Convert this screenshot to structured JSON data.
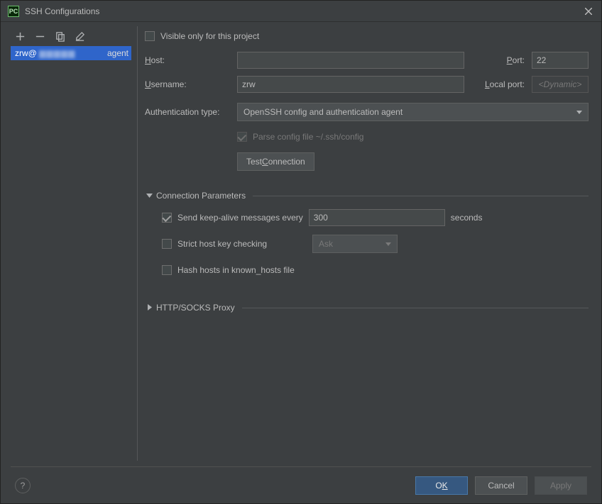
{
  "titlebar": {
    "app_icon_text": "PC",
    "title": "SSH Configurations"
  },
  "sidebar": {
    "selected": {
      "label": "zrw@",
      "method": "agent"
    }
  },
  "form": {
    "visible_only_label": "Visible only for this project",
    "visible_only_checked": false,
    "host_label": "Host:",
    "host_value": "",
    "port_label": "Port:",
    "port_value": "22",
    "username_label": "Username:",
    "username_value": "zrw",
    "local_port_label": "Local port:",
    "local_port_placeholder": "<Dynamic>",
    "auth_type_label": "Authentication type:",
    "auth_type_value": "OpenSSH config and authentication agent",
    "parse_config_label": "Parse config file ~/.ssh/config",
    "parse_config_checked": true,
    "test_connection_label": "Test Connection"
  },
  "conn_params": {
    "title": "Connection Parameters",
    "keepalive_label": "Send keep-alive messages every",
    "keepalive_checked": true,
    "keepalive_value": "300",
    "keepalive_suffix": "seconds",
    "strict_label": "Strict host key checking",
    "strict_checked": false,
    "strict_mode": "Ask",
    "hash_label": "Hash hosts in known_hosts file",
    "hash_checked": false
  },
  "proxy": {
    "title": "HTTP/SOCKS Proxy"
  },
  "footer": {
    "ok": "OK",
    "cancel": "Cancel",
    "apply": "Apply"
  }
}
